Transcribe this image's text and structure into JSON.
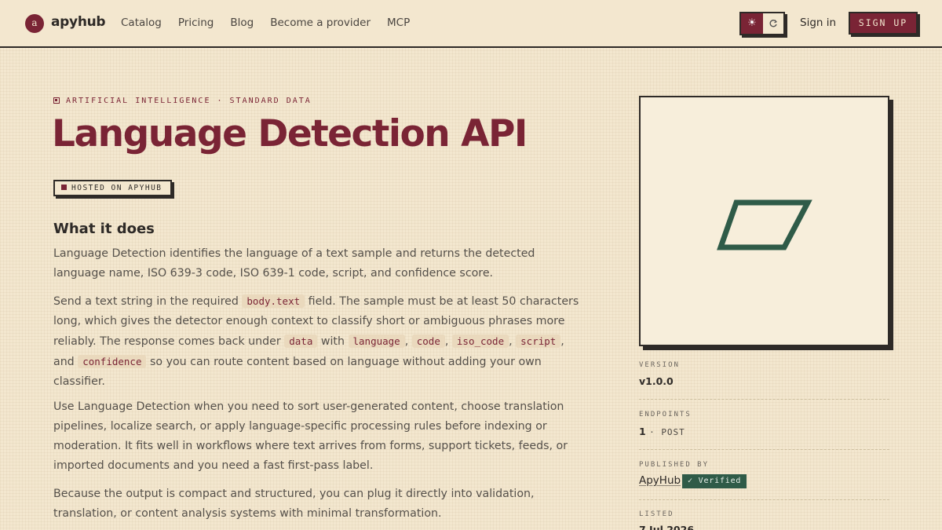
{
  "header": {
    "logo_letter": "a",
    "logo_text": "apyhub",
    "nav": [
      "Catalog",
      "Pricing",
      "Blog",
      "Become a provider",
      "MCP"
    ],
    "sign_in": "Sign in",
    "sign_up": "SIGN UP"
  },
  "eyebrow": "ARTIFICIAL INTELLIGENCE · STANDARD DATA",
  "title": "Language Detection API",
  "hosted_badge": "HOSTED ON APYHUB",
  "section_heading": "What it does",
  "paragraphs": {
    "p1": "Language Detection identifies the language of a text sample and returns the detected language name, ISO 639-3 code, ISO 639-1 code, script, and confidence score.",
    "p2_a": "Send a text string in the required",
    "p2_code1": "body.text",
    "p2_b": "field. The sample must be at least 50 characters long, which gives the detector enough context to classify short or ambiguous phrases more reliably. The response comes back under",
    "p2_code2": "data",
    "p2_c": "with",
    "p2_code3": "language",
    "p2_code4": "code",
    "p2_code5": "iso_code",
    "p2_code6": "script",
    "p2_d": "and",
    "p2_code7": "confidence",
    "p2_e": "so you can route content based on language without adding your own classifier.",
    "p3": "Use Language Detection when you need to sort user-generated content, choose translation pipelines, localize search, or apply language-specific processing rules before indexing or moderation. It fits well in workflows where text arrives from forms, support tickets, feeds, or imported documents and you need a fast first-pass label.",
    "p4": "Because the output is compact and structured, you can plug it directly into validation, translation, or content analysis systems with minimal transformation."
  },
  "meta": {
    "version_label": "VERSION",
    "version_value": "v1.0.0",
    "endpoints_label": "ENDPOINTS",
    "endpoints_count": "1",
    "endpoints_method": "POST",
    "published_label": "PUBLISHED BY",
    "publisher": "ApyHub",
    "verified": "Verified",
    "listed_label": "LISTED",
    "listed_value": "7 Jul 2026"
  },
  "colors": {
    "brand": "#7a2435",
    "verified_green": "#2f5b48",
    "background": "#f3e7cf"
  },
  "icons": [
    "sun-icon",
    "system-theme-icon",
    "check-icon",
    "parallelogram-logo-icon"
  ]
}
